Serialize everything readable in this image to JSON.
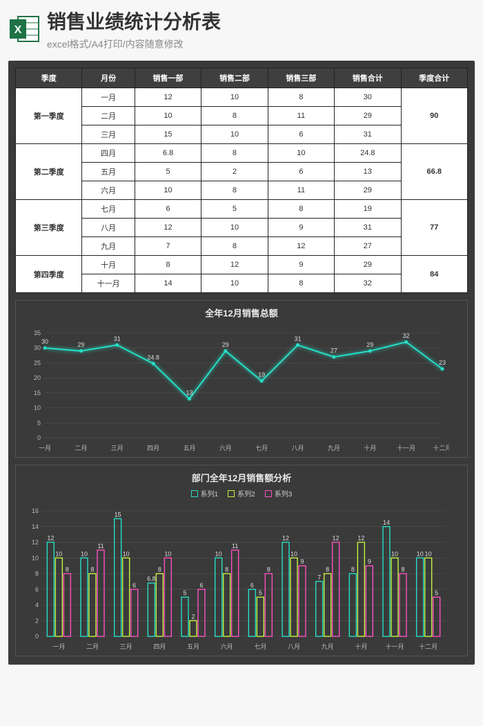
{
  "header": {
    "title": "销售业绩统计分析表",
    "subtitle": "excel格式/A4打印/内容随意修改"
  },
  "table": {
    "headers": [
      "季度",
      "月份",
      "销售一部",
      "销售二部",
      "销售三部",
      "销售合计",
      "季度合计"
    ],
    "quarters": [
      {
        "name": "第一季度",
        "total": "90",
        "rows": [
          {
            "month": "一月",
            "v1": "12",
            "v2": "10",
            "v3": "8",
            "sum": "30"
          },
          {
            "month": "二月",
            "v1": "10",
            "v2": "8",
            "v3": "11",
            "sum": "29"
          },
          {
            "month": "三月",
            "v1": "15",
            "v2": "10",
            "v3": "6",
            "sum": "31"
          }
        ]
      },
      {
        "name": "第二季度",
        "total": "66.8",
        "rows": [
          {
            "month": "四月",
            "v1": "6.8",
            "v2": "8",
            "v3": "10",
            "sum": "24.8"
          },
          {
            "month": "五月",
            "v1": "5",
            "v2": "2",
            "v3": "6",
            "sum": "13"
          },
          {
            "month": "六月",
            "v1": "10",
            "v2": "8",
            "v3": "11",
            "sum": "29"
          }
        ]
      },
      {
        "name": "第三季度",
        "total": "77",
        "rows": [
          {
            "month": "七月",
            "v1": "6",
            "v2": "5",
            "v3": "8",
            "sum": "19"
          },
          {
            "month": "八月",
            "v1": "12",
            "v2": "10",
            "v3": "9",
            "sum": "31"
          },
          {
            "month": "九月",
            "v1": "7",
            "v2": "8",
            "v3": "12",
            "sum": "27"
          }
        ]
      },
      {
        "name": "第四季度",
        "total": "84",
        "rows": [
          {
            "month": "十月",
            "v1": "8",
            "v2": "12",
            "v3": "9",
            "sum": "29"
          },
          {
            "month": "十一月",
            "v1": "14",
            "v2": "10",
            "v3": "8",
            "sum": "32"
          }
        ]
      }
    ]
  },
  "chart_data": [
    {
      "type": "line",
      "title": "全年12月销售总额",
      "categories": [
        "一月",
        "二月",
        "三月",
        "四月",
        "五月",
        "六月",
        "七月",
        "八月",
        "九月",
        "十月",
        "十一月",
        "十二月"
      ],
      "values": [
        30,
        29,
        31,
        24.8,
        13,
        29,
        19,
        31,
        27,
        29,
        32,
        23
      ],
      "ylim": [
        0,
        35
      ],
      "yticks": [
        0,
        5,
        10,
        15,
        20,
        25,
        30,
        35
      ],
      "colors": {
        "line": "#25e0c8"
      }
    },
    {
      "type": "bar",
      "title": "部门全年12月销售额分析",
      "categories": [
        "一月",
        "二月",
        "三月",
        "四月",
        "五月",
        "六月",
        "七月",
        "八月",
        "九月",
        "十月",
        "十一月",
        "十二月"
      ],
      "series": [
        {
          "name": "系列1",
          "color": "#25e0c8",
          "values": [
            12,
            10,
            15,
            6.8,
            5,
            10,
            6,
            12,
            7,
            8,
            14,
            10
          ]
        },
        {
          "name": "系列2",
          "color": "#c5f542",
          "values": [
            10,
            8,
            10,
            8,
            2,
            8,
            5,
            10,
            8,
            12,
            10,
            10
          ]
        },
        {
          "name": "系列3",
          "color": "#ff4fc3",
          "values": [
            8,
            11,
            6,
            10,
            6,
            11,
            8,
            9,
            12,
            9,
            8,
            5
          ]
        }
      ],
      "ylim": [
        0,
        16
      ],
      "yticks": [
        0,
        2,
        4,
        6,
        8,
        10,
        12,
        14,
        16
      ]
    }
  ]
}
